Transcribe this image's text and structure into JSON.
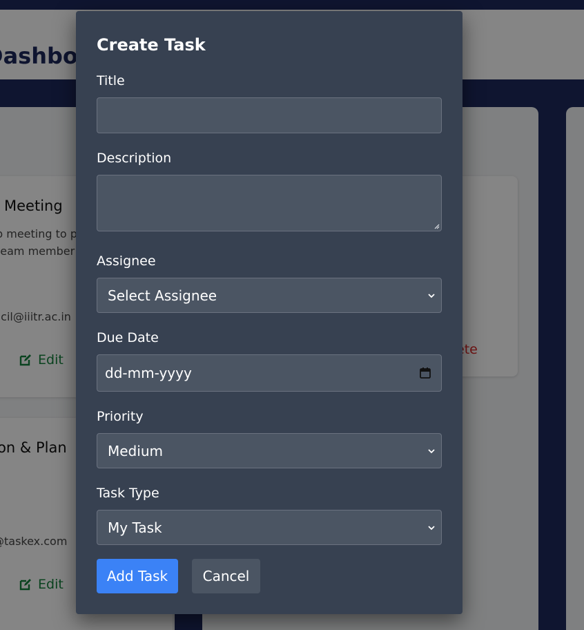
{
  "background": {
    "dashboard_title": "Dashboard",
    "cards": [
      {
        "title": "Meeting",
        "description_lines": [
          "p meeting to p",
          "team member"
        ],
        "email": "ncil@iiitr.ac.in",
        "edit_label": "Edit"
      },
      {
        "delete_label": "ete"
      },
      {
        "title": "tion & Plan",
        "email": "@taskex.com",
        "edit_label": "Edit"
      }
    ]
  },
  "modal": {
    "title": "Create Task",
    "fields": {
      "title": {
        "label": "Title",
        "value": ""
      },
      "description": {
        "label": "Description",
        "value": ""
      },
      "assignee": {
        "label": "Assignee",
        "selected": "Select Assignee"
      },
      "due_date": {
        "label": "Due Date",
        "placeholder": "dd-mm-yyyy"
      },
      "priority": {
        "label": "Priority",
        "selected": "Medium"
      },
      "task_type": {
        "label": "Task Type",
        "selected": "My Task"
      }
    },
    "buttons": {
      "add": "Add Task",
      "cancel": "Cancel"
    }
  },
  "icons": {
    "edit": "edit-icon",
    "chevron": "chevron-down-icon",
    "calendar": "calendar-icon",
    "resize": "resize-handle-icon"
  },
  "colors": {
    "navy": "#1e2a5c",
    "modal_bg": "#374151",
    "input_bg": "#4b5563",
    "primary": "#3b82f6",
    "edit_green": "#15803d",
    "delete_red": "#dc2626"
  }
}
